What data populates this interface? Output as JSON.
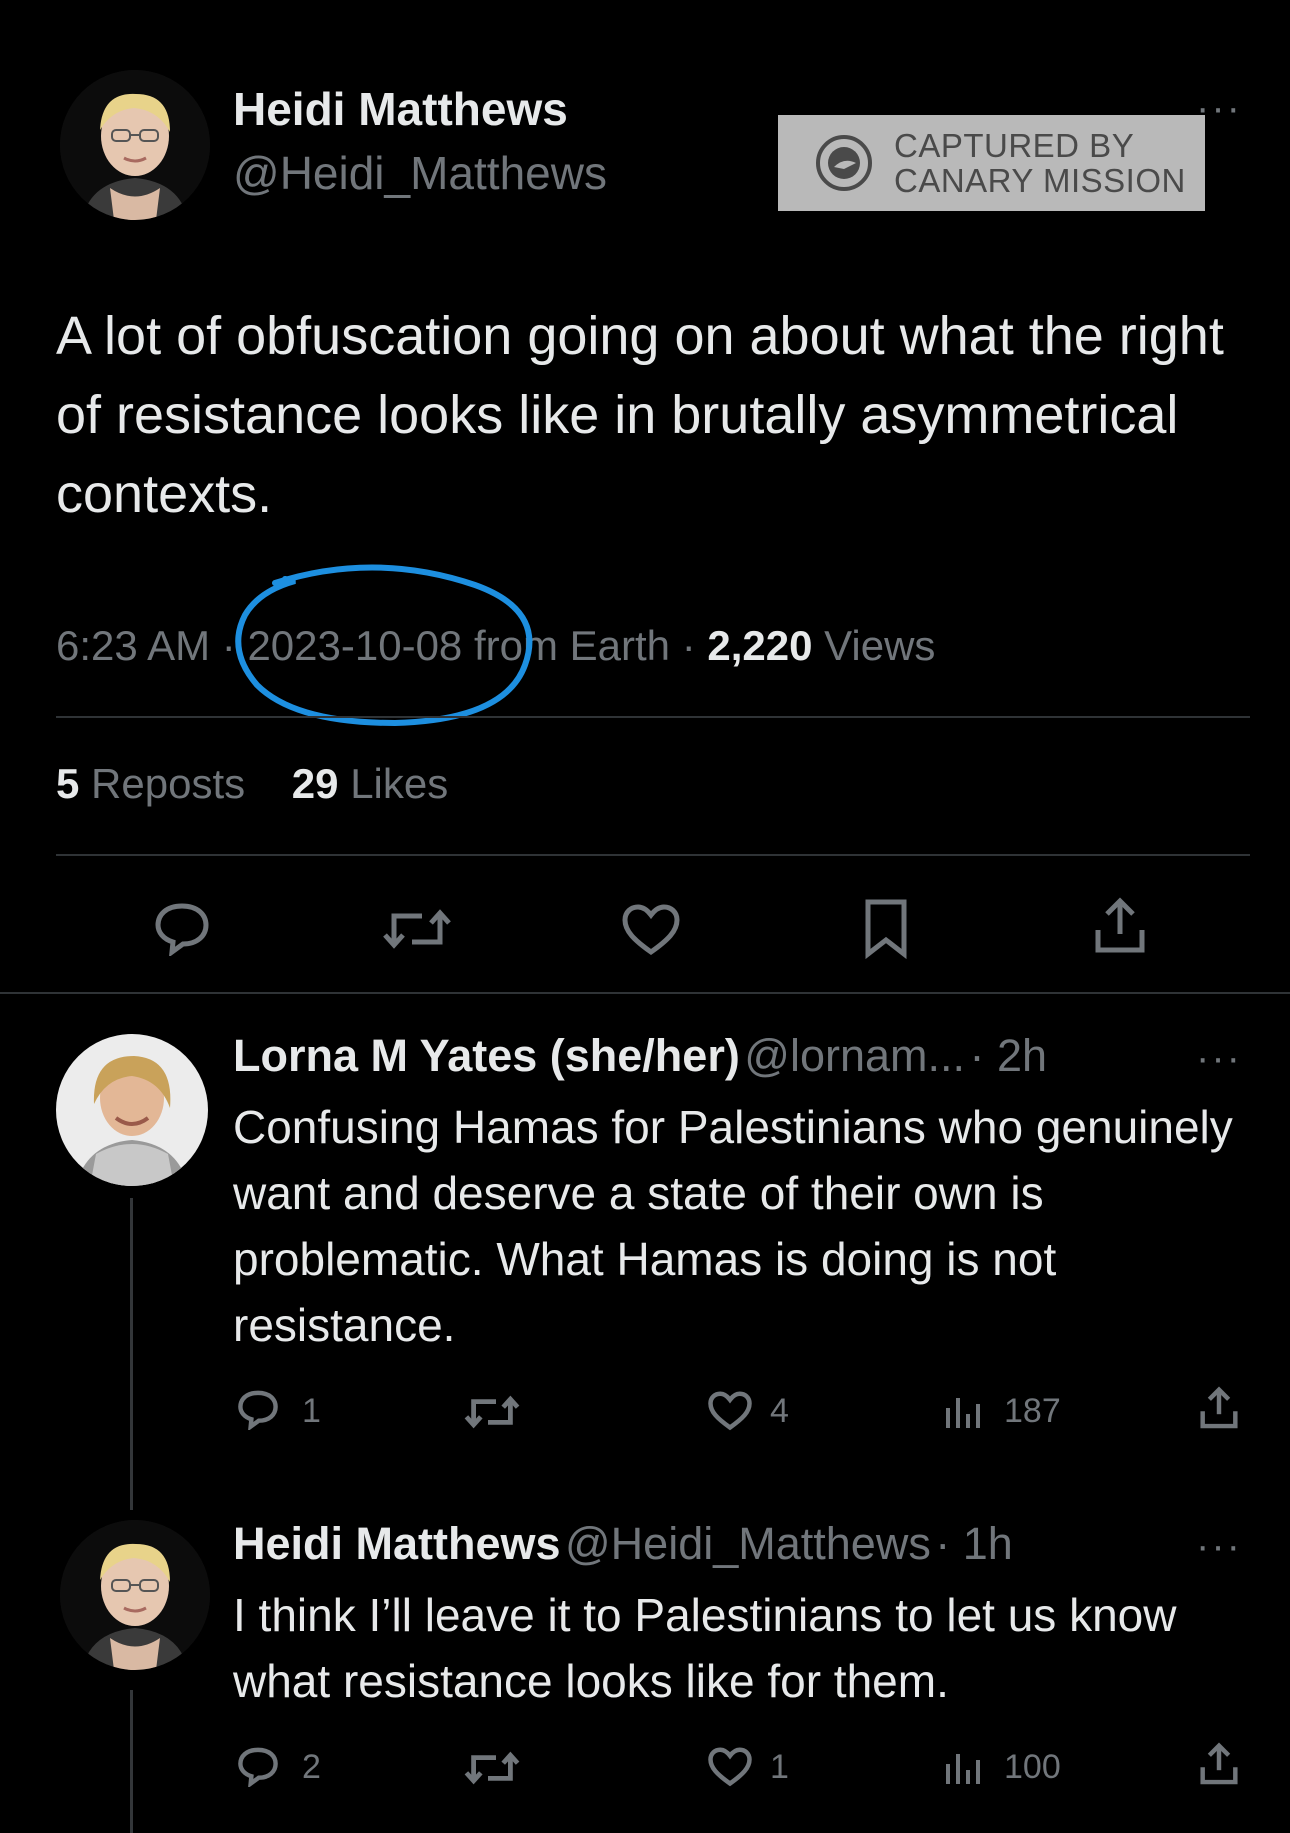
{
  "main_tweet": {
    "author_name": "Heidi Matthews",
    "author_handle": "@Heidi_Matthews",
    "more_label": "···",
    "text": "A lot of obfuscation going on about what the right of resistance looks like in brutally asymmetrical contexts.",
    "time": "6:23 AM",
    "sep1": "·",
    "date": "2023-10-08",
    "location": "from Earth",
    "sep2": "·",
    "views_count": "2,220",
    "views_label": "Views",
    "reposts_count": "5",
    "reposts_label": "Reposts",
    "likes_count": "29",
    "likes_label": "Likes"
  },
  "watermark": {
    "line1": "CAPTURED BY",
    "line2": "CANARY MISSION"
  },
  "replies": [
    {
      "author_name": "Lorna M Yates (she/her)",
      "author_handle": "@lornam...",
      "time": "· 2h",
      "more_label": "···",
      "text": "Confusing Hamas for Palestinians who genuinely want and deserve a state of their own is problematic.  What Hamas is doing is not resistance.",
      "reply_count": "1",
      "like_count": "4",
      "view_count": "187"
    },
    {
      "author_name": "Heidi Matthews",
      "author_handle": "@Heidi_Matthews",
      "time": "· 1h",
      "more_label": "···",
      "text": "I think I’ll leave it to Palestinians to let us know what resistance looks like for them.",
      "reply_count": "2",
      "like_count": "1",
      "view_count": "100"
    }
  ],
  "colors": {
    "background": "#000000",
    "text_primary": "#e7e9ea",
    "text_secondary": "#71767b",
    "divider": "#2f3336",
    "annotation_circle": "#1d8fe0"
  }
}
